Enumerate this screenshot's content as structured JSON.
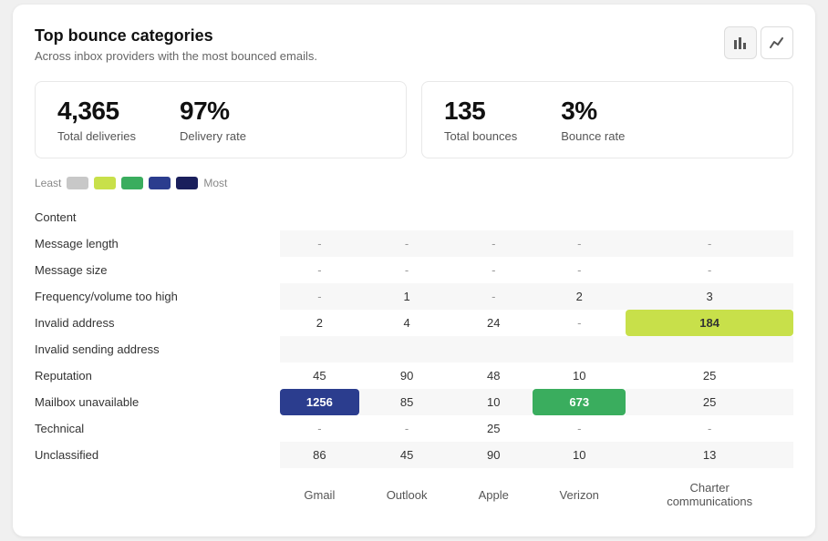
{
  "header": {
    "title": "Top bounce categories",
    "subtitle": "Across inbox providers with the most bounced emails.",
    "btn_bar_icon": "⬛",
    "btn_line_icon": "📈"
  },
  "stats": {
    "left": {
      "value1": "4,365",
      "label1": "Total deliveries",
      "value2": "97%",
      "label2": "Delivery rate"
    },
    "right": {
      "value1": "135",
      "label1": "Total bounces",
      "value2": "3%",
      "label2": "Bounce rate"
    }
  },
  "legend": {
    "least_label": "Least",
    "most_label": "Most",
    "swatches": [
      "#c8c8c8",
      "#c8e04a",
      "#3aad5e",
      "#2b3d8e",
      "#1a1f5c"
    ]
  },
  "table": {
    "columns": [
      "Gmail",
      "Outlook",
      "Apple",
      "Verizon",
      "Charter\ncommunications"
    ],
    "rows": [
      {
        "category": "Content",
        "values": [
          "",
          "",
          "",
          "",
          ""
        ],
        "highlights": []
      },
      {
        "category": "Message length",
        "values": [
          "-",
          "-",
          "-",
          "-",
          "-"
        ],
        "highlights": []
      },
      {
        "category": "Message size",
        "values": [
          "-",
          "-",
          "-",
          "-",
          "-"
        ],
        "highlights": []
      },
      {
        "category": "Frequency/volume too high",
        "values": [
          "-",
          "1",
          "-",
          "2",
          "3"
        ],
        "highlights": []
      },
      {
        "category": "Invalid address",
        "values": [
          "2",
          "4",
          "24",
          "-",
          "184"
        ],
        "highlights": [
          4
        ]
      },
      {
        "category": "Invalid sending address",
        "values": [
          "",
          "",
          "",
          "",
          ""
        ],
        "highlights": []
      },
      {
        "category": "Reputation",
        "values": [
          "45",
          "90",
          "48",
          "10",
          "25"
        ],
        "highlights": []
      },
      {
        "category": "Mailbox unavailable",
        "values": [
          "1256",
          "85",
          "10",
          "673",
          "25"
        ],
        "highlights_special": {
          "0": "blue",
          "3": "green"
        }
      },
      {
        "category": "Technical",
        "values": [
          "-",
          "-",
          "25",
          "-",
          "-"
        ],
        "highlights": []
      },
      {
        "category": "Unclassified",
        "values": [
          "86",
          "45",
          "90",
          "10",
          "13"
        ],
        "highlights": []
      }
    ]
  }
}
